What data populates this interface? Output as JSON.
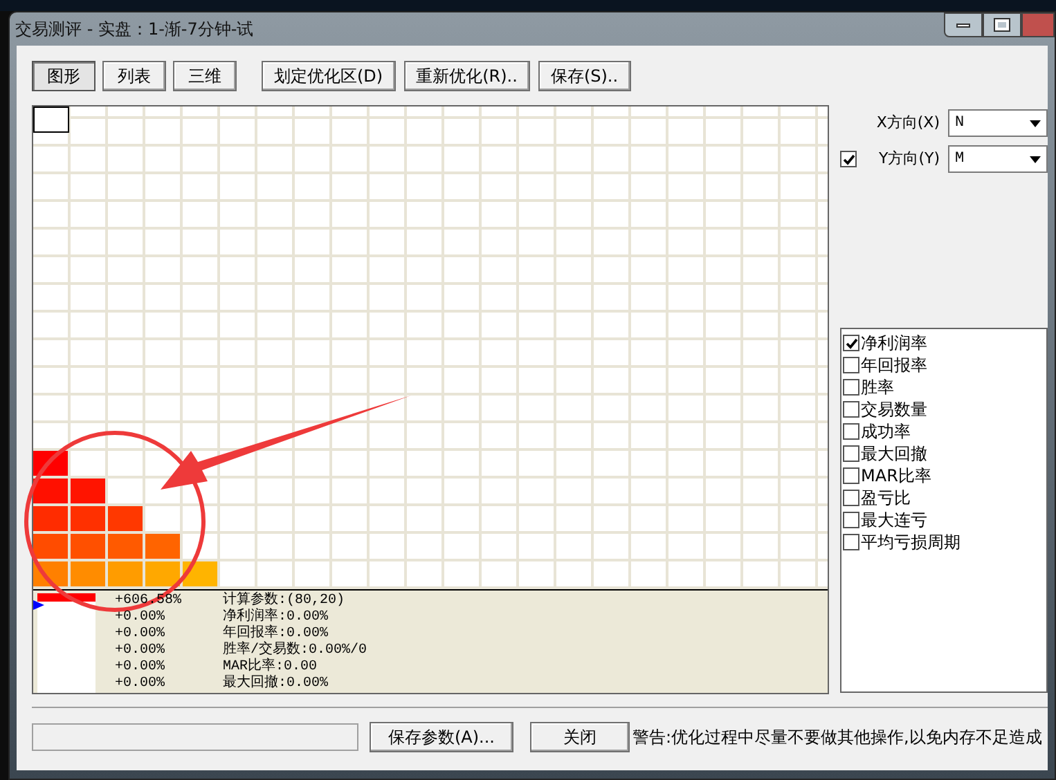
{
  "window": {
    "title": "交易测评 - 实盘：1-渐-7分钟-试"
  },
  "view_tabs": [
    {
      "label": "图形",
      "selected": true
    },
    {
      "label": "列表",
      "selected": false
    },
    {
      "label": "三维",
      "selected": false
    }
  ],
  "toolbar_buttons": [
    "划定优化区(D)",
    "重新优化(R)..",
    "保存(S).."
  ],
  "heatmap": {
    "rows": [
      {
        "cells": [
          {
            "color": "#ff8000"
          },
          {
            "color": "#ff8c00"
          },
          {
            "color": "#ff9c00"
          },
          {
            "color": "#ffa800"
          },
          {
            "color": "#ffb400"
          }
        ]
      },
      {
        "cells": [
          {
            "color": "#ff4c00"
          },
          {
            "color": "#ff5000"
          },
          {
            "color": "#ff5a00"
          },
          {
            "color": "#ff6400"
          }
        ]
      },
      {
        "cells": [
          {
            "color": "#ff2c00"
          },
          {
            "color": "#ff3000"
          },
          {
            "color": "#ff3800"
          }
        ]
      },
      {
        "cells": [
          {
            "color": "#ff1000"
          },
          {
            "color": "#ff1400"
          }
        ]
      },
      {
        "cells": [
          {
            "color": "#ff0000"
          }
        ]
      }
    ]
  },
  "legend": {
    "values": [
      "+606.58%",
      "+0.00%",
      "+0.00%",
      "+0.00%",
      "+0.00%",
      "+0.00%"
    ],
    "details": [
      "计算参数:(80,20)",
      "净利润率:0.00%",
      "年回报率:0.00%",
      "胜率/交易数:0.00%/0",
      "MAR比率:0.00",
      "最大回撤:0.00%"
    ]
  },
  "x_axis": {
    "label": "X方向(X)",
    "value": "N"
  },
  "y_axis": {
    "label": "Y方向(Y)",
    "checked": true,
    "value": "M"
  },
  "metrics": [
    {
      "label": "净利润率",
      "checked": true
    },
    {
      "label": "年回报率",
      "checked": false
    },
    {
      "label": "胜率",
      "checked": false
    },
    {
      "label": "交易数量",
      "checked": false
    },
    {
      "label": "成功率",
      "checked": false
    },
    {
      "label": "最大回撤",
      "checked": false
    },
    {
      "label": "MAR比率",
      "checked": false
    },
    {
      "label": "盈亏比",
      "checked": false
    },
    {
      "label": "最大连亏",
      "checked": false
    },
    {
      "label": "平均亏损周期",
      "checked": false
    }
  ],
  "bottom_buttons": [
    "保存参数(A)...",
    "关闭"
  ],
  "warning": "警告:优化过程中尽量不要做其他操作,以免内存不足造成"
}
